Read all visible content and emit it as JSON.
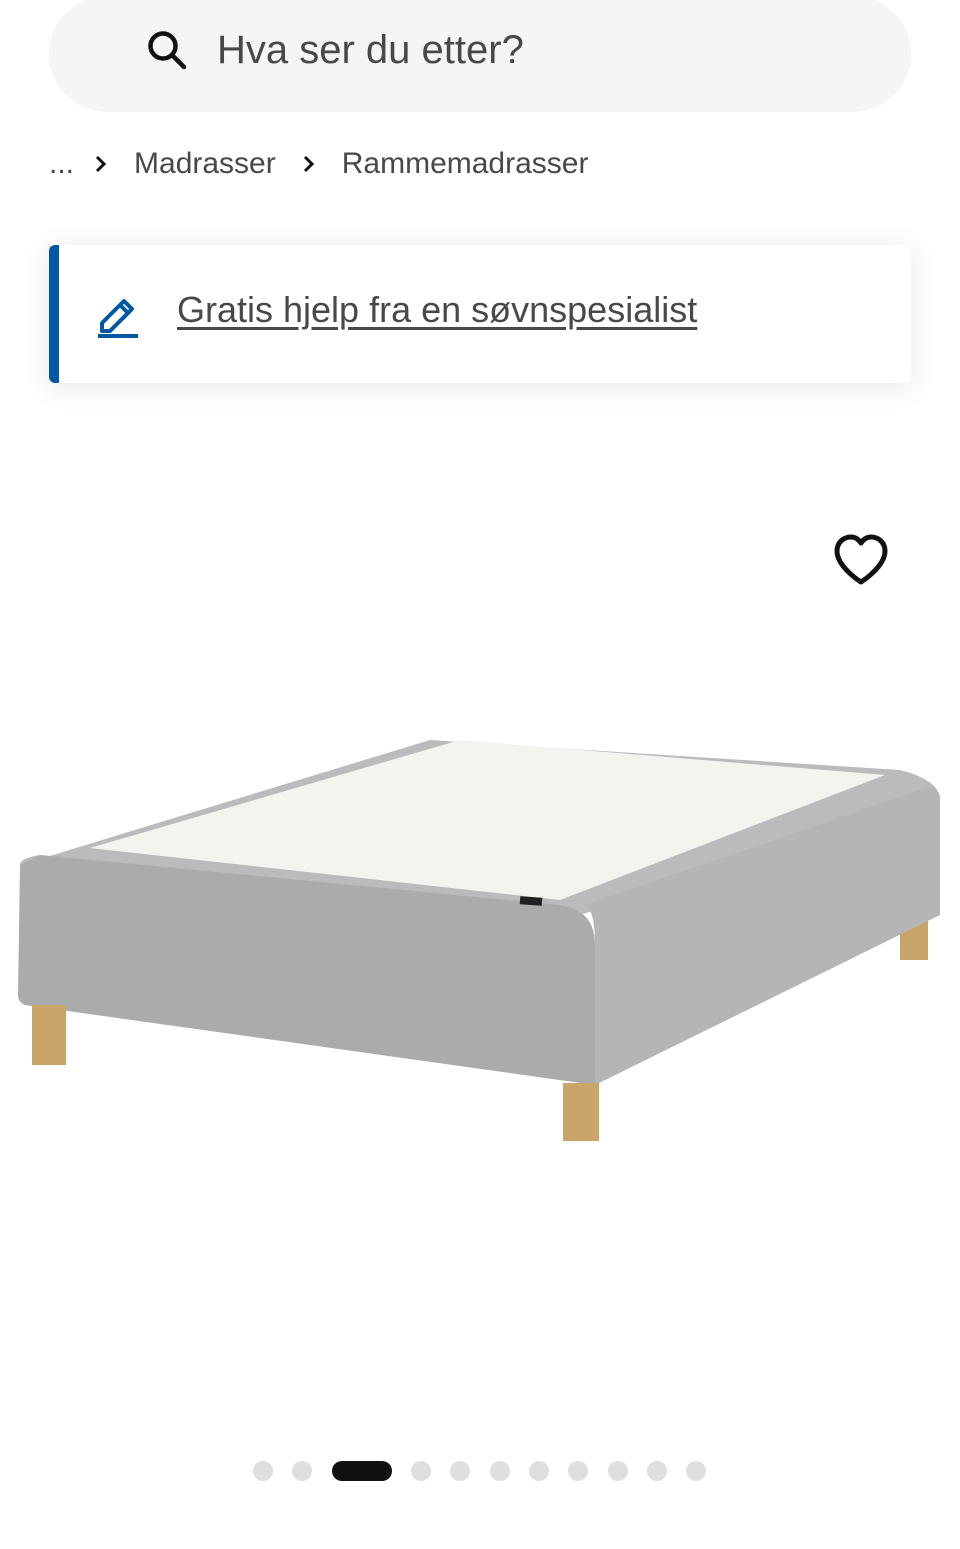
{
  "search": {
    "placeholder": "Hva ser du etter?",
    "icon": "search-icon"
  },
  "breadcrumb": {
    "items": [
      "...",
      "Madrasser",
      "Rammemadrasser"
    ]
  },
  "banner": {
    "link_text": "Gratis hjelp fra en søvnspesialist",
    "icon": "edit-pencil-icon",
    "accent_color": "#0058a3"
  },
  "product": {
    "favorite_icon": "heart-outline-icon",
    "image": "upholstered-bed-base-grey-icon"
  },
  "carousel": {
    "total": 11,
    "active_index": 3
  }
}
